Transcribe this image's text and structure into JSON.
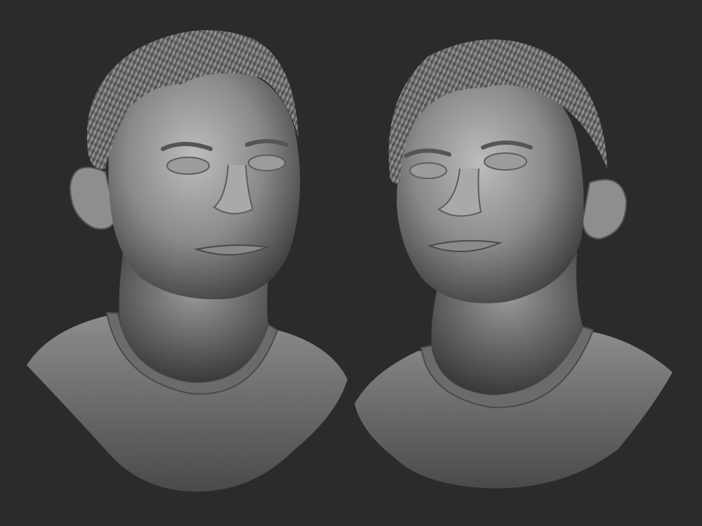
{
  "scene": {
    "background": "#2b2b2b",
    "subject": "clay-sculpt-bust",
    "views": [
      {
        "view": "three-quarter-left",
        "icon": "bust-sculpt"
      },
      {
        "view": "three-quarter-right",
        "icon": "bust-sculpt"
      }
    ]
  },
  "palette": {
    "clay_light": "#b9b9b9",
    "clay_mid": "#7c7c7c",
    "clay_dark": "#3a3a3a",
    "shadow": "#1e1e1e"
  }
}
